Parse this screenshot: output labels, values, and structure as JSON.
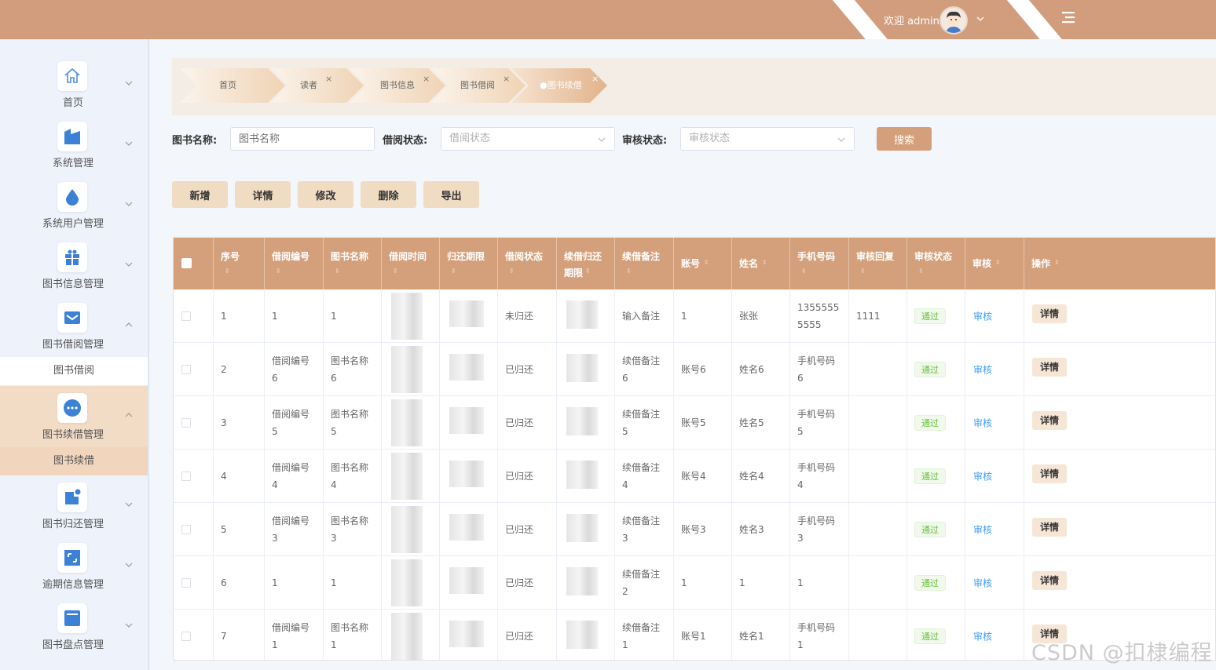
{
  "header": {
    "welcome": "欢迎 admin",
    "bg_color": "#d19d7c"
  },
  "sidebar": {
    "items": [
      {
        "label": "首页",
        "icon": "home-icon"
      },
      {
        "label": "系统管理",
        "icon": "folder-icon"
      },
      {
        "label": "系统用户管理",
        "icon": "drop-icon"
      },
      {
        "label": "图书信息管理",
        "icon": "gift-icon"
      },
      {
        "label": "图书借阅管理",
        "icon": "mail-icon"
      },
      {
        "label": "图书续借管理",
        "icon": "chat-icon"
      },
      {
        "label": "图书归还管理",
        "icon": "notification-icon"
      },
      {
        "label": "逾期信息管理",
        "icon": "expand-icon"
      },
      {
        "label": "图书盘点管理",
        "icon": "card-icon"
      }
    ],
    "sub_borrow": "图书借阅",
    "sub_renew": "图书续借"
  },
  "tabs": [
    {
      "label": "首页"
    },
    {
      "label": "读者"
    },
    {
      "label": "图书信息"
    },
    {
      "label": "图书借阅"
    },
    {
      "label": "●图书续借"
    }
  ],
  "search": {
    "book_name_label": "图书名称:",
    "book_name_placeholder": "图书名称",
    "borrow_status_label": "借阅状态:",
    "borrow_status_placeholder": "借阅状态",
    "audit_status_label": "审核状态:",
    "audit_status_placeholder": "审核状态",
    "search_button": "搜索"
  },
  "toolbar": {
    "add": "新增",
    "detail": "详情",
    "edit": "修改",
    "delete": "删除",
    "export": "导出"
  },
  "table": {
    "headers": {
      "index": "序号",
      "borrow_no": "借阅编号",
      "book_name": "图书名称",
      "borrow_time": "借阅时间",
      "return_deadline": "归还期限",
      "borrow_status": "借阅状态",
      "renew_deadline_1": "续借归还",
      "renew_deadline_2": "期限",
      "renew_note": "续借备注",
      "account": "账号",
      "name": "姓名",
      "phone": "手机号码",
      "audit_reply": "审核回复",
      "audit_status": "审核状态",
      "audit": "审核",
      "action": "操作"
    },
    "audit_link": "审核",
    "detail_button": "详情",
    "rows": [
      {
        "index": "1",
        "borrow_no": "1",
        "borrow_no2": "",
        "book_name": "1",
        "book_name2": "",
        "status": "未归还",
        "note": "输入备注",
        "note2": "",
        "account": "1",
        "name": "张张",
        "phone": "1355555",
        "phone2": "5555",
        "reply": "1111",
        "audit_status": "通过"
      },
      {
        "index": "2",
        "borrow_no": "借阅编号",
        "borrow_no2": "6",
        "book_name": "图书名称",
        "book_name2": "6",
        "status": "已归还",
        "note": "续借备注",
        "note2": "6",
        "account": "账号6",
        "name": "姓名6",
        "phone": "手机号码",
        "phone2": "6",
        "reply": "",
        "audit_status": "通过"
      },
      {
        "index": "3",
        "borrow_no": "借阅编号",
        "borrow_no2": "5",
        "book_name": "图书名称",
        "book_name2": "5",
        "status": "已归还",
        "note": "续借备注",
        "note2": "5",
        "account": "账号5",
        "name": "姓名5",
        "phone": "手机号码",
        "phone2": "5",
        "reply": "",
        "audit_status": "通过"
      },
      {
        "index": "4",
        "borrow_no": "借阅编号",
        "borrow_no2": "4",
        "book_name": "图书名称",
        "book_name2": "4",
        "status": "已归还",
        "note": "续借备注",
        "note2": "4",
        "account": "账号4",
        "name": "姓名4",
        "phone": "手机号码",
        "phone2": "4",
        "reply": "",
        "audit_status": "通过"
      },
      {
        "index": "5",
        "borrow_no": "借阅编号",
        "borrow_no2": "3",
        "book_name": "图书名称",
        "book_name2": "3",
        "status": "已归还",
        "note": "续借备注",
        "note2": "3",
        "account": "账号3",
        "name": "姓名3",
        "phone": "手机号码",
        "phone2": "3",
        "reply": "",
        "audit_status": "通过"
      },
      {
        "index": "6",
        "borrow_no": "1",
        "borrow_no2": "",
        "book_name": "1",
        "book_name2": "",
        "status": "已归还",
        "note": "续借备注",
        "note2": "2",
        "account": "1",
        "name": "1",
        "phone": "1",
        "phone2": "",
        "reply": "",
        "audit_status": "通过"
      },
      {
        "index": "7",
        "borrow_no": "借阅编号",
        "borrow_no2": "1",
        "book_name": "图书名称",
        "book_name2": "1",
        "status": "已归还",
        "note": "续借备注",
        "note2": "1",
        "account": "账号1",
        "name": "姓名1",
        "phone": "手机号码",
        "phone2": "1",
        "reply": "",
        "audit_status": "通过"
      }
    ]
  },
  "watermark": "CSDN @扣棣编程"
}
